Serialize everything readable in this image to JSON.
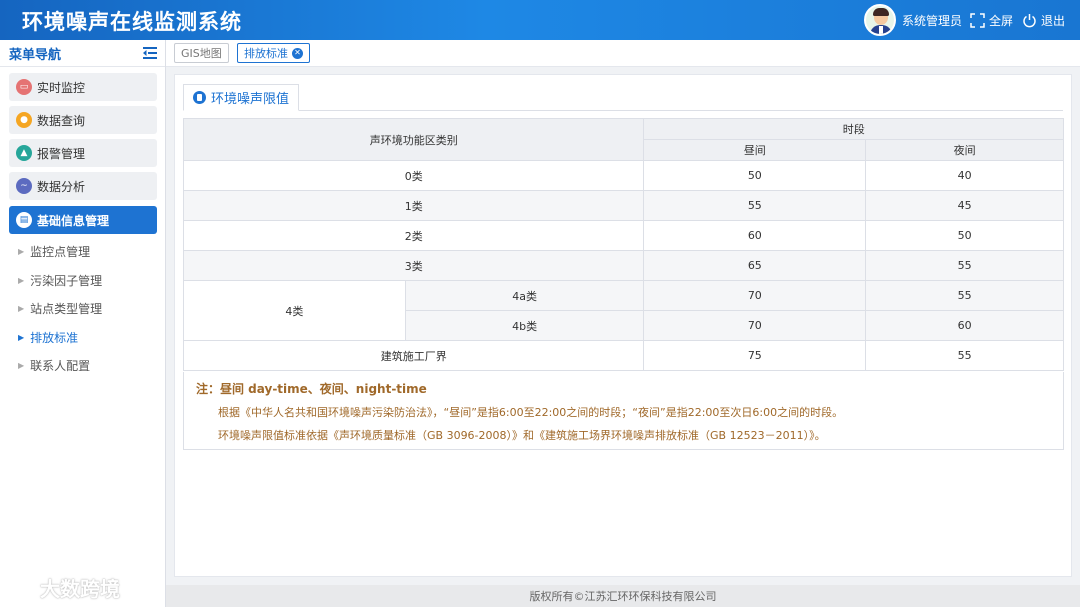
{
  "header": {
    "title": "环境噪声在线监测系统",
    "user_name": "系统管理员",
    "fullscreen_label": "全屏",
    "logout_label": "退出"
  },
  "sidebar": {
    "title": "菜单导航",
    "menu": [
      {
        "label": "实时监控",
        "icon": "monitor-icon",
        "color": "#e57373"
      },
      {
        "label": "数据查询",
        "icon": "database-icon",
        "color": "#f5a623"
      },
      {
        "label": "报警管理",
        "icon": "alarm-icon",
        "color": "#26a69a"
      },
      {
        "label": "数据分析",
        "icon": "chart-icon",
        "color": "#5c6bc0"
      },
      {
        "label": "基础信息管理",
        "icon": "info-icon",
        "color": "#1e73d2"
      }
    ],
    "submenu": [
      {
        "label": "监控点管理"
      },
      {
        "label": "污染因子管理"
      },
      {
        "label": "站点类型管理"
      },
      {
        "label": "排放标准"
      },
      {
        "label": "联系人配置"
      }
    ]
  },
  "tabs": [
    {
      "label": "GIS地图"
    },
    {
      "label": "排放标准"
    }
  ],
  "panel": {
    "tab_label": "环境噪声限值",
    "table": {
      "col_category": "声环境功能区类别",
      "col_period": "时段",
      "col_day": "昼间",
      "col_night": "夜间",
      "rows": [
        {
          "category": "0类",
          "day": "50",
          "night": "40"
        },
        {
          "category": "1类",
          "day": "55",
          "night": "45"
        },
        {
          "category": "2类",
          "day": "60",
          "night": "50"
        },
        {
          "category": "3类",
          "day": "65",
          "night": "55"
        },
        {
          "category": "4类",
          "sub": "4a类",
          "day": "70",
          "night": "55"
        },
        {
          "sub": "4b类",
          "day": "70",
          "night": "60"
        },
        {
          "category": "建筑施工厂界",
          "day": "75",
          "night": "55"
        }
      ]
    },
    "notes": {
      "line1": "注：昼间 day-time、夜间、night-time",
      "line2": "根据《中华人名共和国环境噪声污染防治法》，“昼间”是指6:00至22:00之间的时段；“夜间”是指22:00至次日6:00之间的时段。",
      "line3": "环境噪声限值标准依据《声环境质量标准（GB 3096-2008）》和《建筑施工场界环境噪声排放标准（GB 12523－2011）》。"
    }
  },
  "footer": {
    "copyright": "版权所有©江苏汇环环保科技有限公司"
  },
  "watermark": {
    "text": "大数跨境"
  }
}
